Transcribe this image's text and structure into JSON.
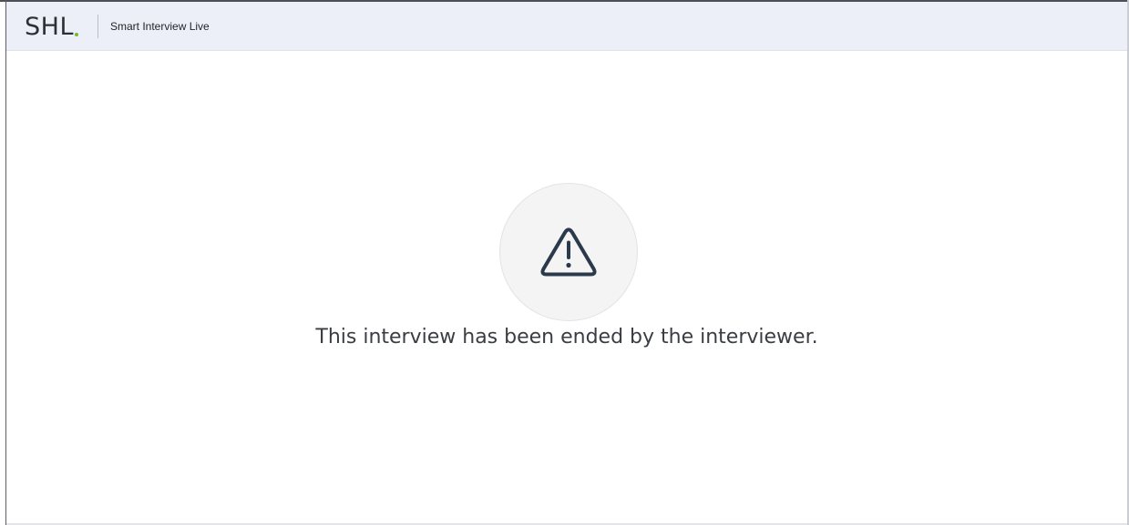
{
  "header": {
    "logo_text": "SHL",
    "logo_dot_color": "#7ab929",
    "product_name": "Smart Interview Live"
  },
  "main": {
    "status_icon": "warning-triangle-icon",
    "message": "This interview has been ended by the interviewer."
  },
  "colors": {
    "header_bg": "#eceff7",
    "icon_stroke": "#2b3a4a",
    "circle_bg": "#f4f4f5"
  }
}
